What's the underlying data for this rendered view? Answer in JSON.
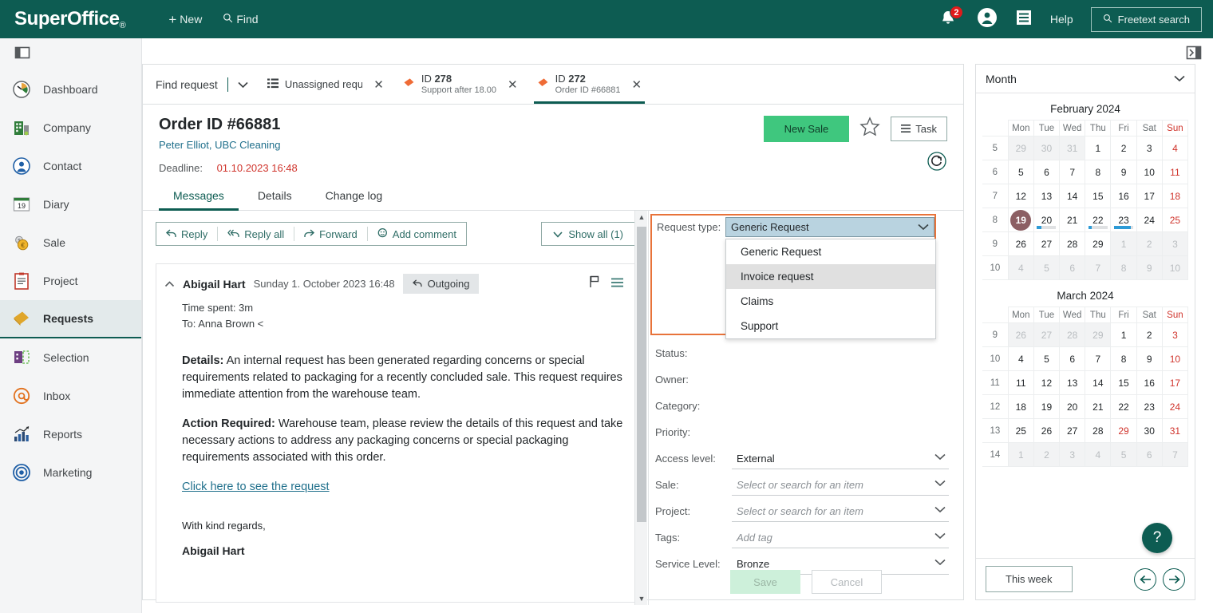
{
  "topbar": {
    "logo": "SuperOffice",
    "logo_reg": "®",
    "new_label": "New",
    "find_label": "Find",
    "notification_count": "2",
    "help_label": "Help",
    "freetext_label": "Freetext search",
    "bg_color": "#0d5c52"
  },
  "sidebar": {
    "items": [
      {
        "label": "Dashboard",
        "icon": "dashboard-icon"
      },
      {
        "label": "Company",
        "icon": "company-icon"
      },
      {
        "label": "Contact",
        "icon": "contact-icon"
      },
      {
        "label": "Diary",
        "icon": "diary-icon"
      },
      {
        "label": "Sale",
        "icon": "sale-icon"
      },
      {
        "label": "Project",
        "icon": "project-icon"
      },
      {
        "label": "Requests",
        "icon": "requests-icon"
      },
      {
        "label": "Selection",
        "icon": "selection-icon"
      },
      {
        "label": "Inbox",
        "icon": "inbox-icon"
      },
      {
        "label": "Reports",
        "icon": "reports-icon"
      },
      {
        "label": "Marketing",
        "icon": "marketing-icon"
      }
    ],
    "active": "Requests"
  },
  "tabbar": {
    "find_request": "Find request",
    "tabs": [
      {
        "label": "Unassigned request",
        "icon": "list-icon",
        "active": false
      },
      {
        "id_prefix": "ID",
        "id": "278",
        "subtitle": "Support after 18.00",
        "icon": "request-icon",
        "active": false
      },
      {
        "id_prefix": "ID",
        "id": "272",
        "subtitle": "Order ID #66881",
        "icon": "request-icon",
        "active": true
      }
    ]
  },
  "request": {
    "title": "Order ID #66881",
    "contact": "Peter Elliot, UBC Cleaning",
    "deadline_label": "Deadline:",
    "deadline_value": "01.10.2023 16:48",
    "new_sale_label": "New Sale",
    "task_label": "Task",
    "subtabs": [
      {
        "label": "Messages",
        "active": true
      },
      {
        "label": "Details",
        "active": false
      },
      {
        "label": "Change log",
        "active": false
      }
    ]
  },
  "message_toolbar": {
    "reply": "Reply",
    "reply_all": "Reply all",
    "forward": "Forward",
    "add_comment": "Add comment",
    "show_all": "Show all (1)"
  },
  "message": {
    "author": "Abigail Hart",
    "date": "Sunday 1. October 2023 16:48",
    "direction": "Outgoing",
    "time_spent": "Time spent: 3m",
    "recipient": "To: Anna Brown <",
    "details_label": "Details:",
    "details_text": " An internal request has been generated regarding concerns or special requirements related to packaging for a recently concluded sale. This request requires immediate attention from the warehouse team.",
    "action_label": "Action Required:",
    "action_text": " Warehouse team, please review the details of this request and take necessary actions to address any packaging concerns or special packaging requirements associated with this order.",
    "link": "Click here to see the request",
    "closing": "With kind regards,",
    "signature": "Abigail Hart"
  },
  "form": {
    "request_type": {
      "label": "Request type:",
      "value": "Generic Request",
      "options": [
        "Generic Request",
        "Invoice request",
        "Claims",
        "Support"
      ],
      "highlighted_option": "Invoice request",
      "highlight_border_color": "#e8733a",
      "field_bg_color": "#b9d3e0"
    },
    "fields": [
      {
        "label": "Status:",
        "value": "",
        "placeholder": ""
      },
      {
        "label": "Owner:",
        "value": "",
        "placeholder": ""
      },
      {
        "label": "Category:",
        "value": "",
        "placeholder": ""
      },
      {
        "label": "Priority:",
        "value": "",
        "placeholder": ""
      },
      {
        "label": "Access level:",
        "value": "External",
        "placeholder": ""
      },
      {
        "label": "Sale:",
        "value": "",
        "placeholder": "Select or search for an item"
      },
      {
        "label": "Project:",
        "value": "",
        "placeholder": "Select or search for an item"
      },
      {
        "label": "Tags:",
        "value": "",
        "placeholder": "Add tag"
      },
      {
        "label": "Service Level:",
        "value": "Bronze",
        "placeholder": ""
      }
    ],
    "save_label": "Save",
    "cancel_label": "Cancel"
  },
  "right_panel": {
    "view_selector": "Month",
    "weekday_headers": [
      "Mon",
      "Tue",
      "Wed",
      "Thu",
      "Fri",
      "Sat",
      "Sun"
    ],
    "this_week_label": "This week",
    "help_label": "?",
    "calendars": [
      {
        "title": "February 2024",
        "weeks": [
          {
            "wk": "5",
            "days": [
              {
                "n": "29",
                "dim": true
              },
              {
                "n": "30",
                "dim": true
              },
              {
                "n": "31",
                "dim": true
              },
              {
                "n": "1"
              },
              {
                "n": "2"
              },
              {
                "n": "3"
              },
              {
                "n": "4",
                "sun": true
              }
            ]
          },
          {
            "wk": "6",
            "days": [
              {
                "n": "5"
              },
              {
                "n": "6"
              },
              {
                "n": "7"
              },
              {
                "n": "8"
              },
              {
                "n": "9"
              },
              {
                "n": "10"
              },
              {
                "n": "11",
                "sun": true
              }
            ]
          },
          {
            "wk": "7",
            "days": [
              {
                "n": "12"
              },
              {
                "n": "13"
              },
              {
                "n": "14"
              },
              {
                "n": "15"
              },
              {
                "n": "16"
              },
              {
                "n": "17"
              },
              {
                "n": "18",
                "sun": true
              }
            ]
          },
          {
            "wk": "8",
            "days": [
              {
                "n": "19",
                "selected": true
              },
              {
                "n": "20",
                "event": true,
                "fill": 22
              },
              {
                "n": "21"
              },
              {
                "n": "22",
                "event": true,
                "fill": 18
              },
              {
                "n": "23",
                "event": true,
                "fill": 88
              },
              {
                "n": "24"
              },
              {
                "n": "25",
                "sun": true
              }
            ]
          },
          {
            "wk": "9",
            "days": [
              {
                "n": "26"
              },
              {
                "n": "27"
              },
              {
                "n": "28"
              },
              {
                "n": "29"
              },
              {
                "n": "1",
                "dim": true
              },
              {
                "n": "2",
                "dim": true
              },
              {
                "n": "3",
                "dim": true
              }
            ]
          },
          {
            "wk": "10",
            "days": [
              {
                "n": "4",
                "dim": true
              },
              {
                "n": "5",
                "dim": true
              },
              {
                "n": "6",
                "dim": true
              },
              {
                "n": "7",
                "dim": true
              },
              {
                "n": "8",
                "dim": true
              },
              {
                "n": "9",
                "dim": true
              },
              {
                "n": "10",
                "dim": true
              }
            ]
          }
        ]
      },
      {
        "title": "March 2024",
        "weeks": [
          {
            "wk": "9",
            "days": [
              {
                "n": "26",
                "dim": true
              },
              {
                "n": "27",
                "dim": true
              },
              {
                "n": "28",
                "dim": true
              },
              {
                "n": "29",
                "dim": true
              },
              {
                "n": "1"
              },
              {
                "n": "2"
              },
              {
                "n": "3",
                "sun": true
              }
            ]
          },
          {
            "wk": "10",
            "days": [
              {
                "n": "4"
              },
              {
                "n": "5"
              },
              {
                "n": "6"
              },
              {
                "n": "7"
              },
              {
                "n": "8"
              },
              {
                "n": "9"
              },
              {
                "n": "10",
                "sun": true
              }
            ]
          },
          {
            "wk": "11",
            "days": [
              {
                "n": "11"
              },
              {
                "n": "12"
              },
              {
                "n": "13"
              },
              {
                "n": "14"
              },
              {
                "n": "15"
              },
              {
                "n": "16"
              },
              {
                "n": "17",
                "sun": true
              }
            ]
          },
          {
            "wk": "12",
            "days": [
              {
                "n": "18"
              },
              {
                "n": "19"
              },
              {
                "n": "20"
              },
              {
                "n": "21"
              },
              {
                "n": "22"
              },
              {
                "n": "23"
              },
              {
                "n": "24",
                "sun": true
              }
            ]
          },
          {
            "wk": "13",
            "days": [
              {
                "n": "25"
              },
              {
                "n": "26"
              },
              {
                "n": "27"
              },
              {
                "n": "28"
              },
              {
                "n": "29",
                "sun": true
              },
              {
                "n": "30"
              },
              {
                "n": "31",
                "sun": true
              }
            ]
          },
          {
            "wk": "14",
            "days": [
              {
                "n": "1",
                "dim": true
              },
              {
                "n": "2",
                "dim": true
              },
              {
                "n": "3",
                "dim": true
              },
              {
                "n": "4",
                "dim": true
              },
              {
                "n": "5",
                "dim": true
              },
              {
                "n": "6",
                "dim": true
              },
              {
                "n": "7",
                "dim": true
              }
            ]
          }
        ]
      }
    ]
  }
}
